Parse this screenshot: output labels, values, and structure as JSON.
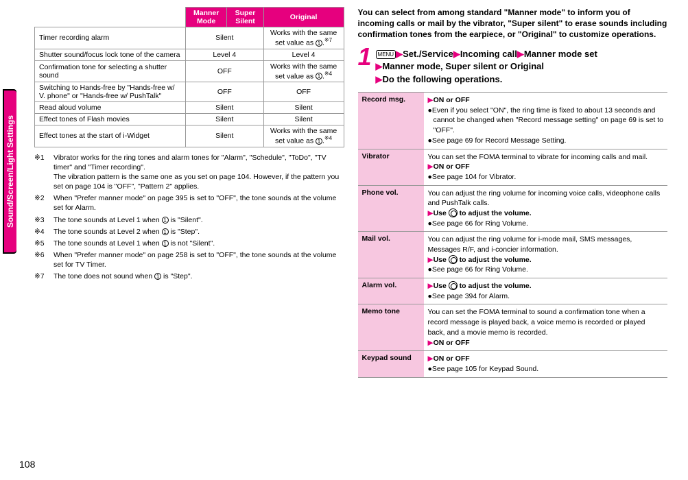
{
  "sideLabel": "Sound/Screen/Light Settings",
  "pageNumber": "108",
  "leftTable": {
    "headers": [
      "",
      "Manner Mode",
      "Super Silent",
      "Original"
    ],
    "rows": [
      {
        "label": "Timer recording alarm",
        "manner": "Silent",
        "super": "",
        "original": "Works with the same set value as ①.※7",
        "mergeMS": true
      },
      {
        "label": "Shutter sound/focus lock tone of the camera",
        "manner": "Level 4",
        "super": "",
        "original": "Level 4",
        "mergeMS": true
      },
      {
        "label": "Confirmation tone for selecting a shutter sound",
        "manner": "OFF",
        "super": "",
        "original": "Works with the same set value as ①.※4",
        "mergeMS": true
      },
      {
        "label": "Switching to Hands-free by \"Hands-free w/ V. phone\" or \"Hands-free w/ PushTalk\"",
        "manner": "OFF",
        "super": "",
        "original": "OFF",
        "mergeMS": true
      },
      {
        "label": "Read aloud volume",
        "manner": "Silent",
        "super": "",
        "original": "Silent",
        "mergeMS": true
      },
      {
        "label": "Effect tones of Flash movies",
        "manner": "Silent",
        "super": "",
        "original": "Silent",
        "mergeMS": true
      },
      {
        "label": "Effect tones at the start of i-Widget",
        "manner": "Silent",
        "super": "",
        "original": "Works with the same set value as ①.※4",
        "mergeMS": true
      }
    ]
  },
  "notes": [
    {
      "marker": "※1",
      "text": "Vibrator works for the ring tones and alarm tones for \"Alarm\", \"Schedule\", \"ToDo\", \"TV timer\" and \"Timer recording\".\nThe vibration pattern is the same one as you set on page 104. However, if the pattern you set on page 104 is \"OFF\", \"Pattern 2\" applies."
    },
    {
      "marker": "※2",
      "text": "When \"Prefer manner mode\" on page 395 is set to \"OFF\", the tone sounds at the volume set for Alarm."
    },
    {
      "marker": "※3",
      "text": "The tone sounds at Level 1 when ① is \"Silent\"."
    },
    {
      "marker": "※4",
      "text": "The tone sounds at Level 2 when ① is \"Step\"."
    },
    {
      "marker": "※5",
      "text": "The tone sounds at Level 1 when ① is not \"Silent\"."
    },
    {
      "marker": "※6",
      "text": "When \"Prefer manner mode\" on page 258 is set to \"OFF\", the tone sounds at the volume set for TV Timer."
    },
    {
      "marker": "※7",
      "text": "The tone does not sound when ① is \"Step\"."
    }
  ],
  "intro": "You can select from among standard \"Manner mode\" to inform you of incoming calls or mail by the vibrator, \"Super silent\" to erase sounds including confirmation tones from the earpiece, or \"Original\" to customize operations.",
  "step": {
    "num": "1",
    "menuKey": "MENU",
    "line1a": "Set./Service",
    "line1b": "Incoming call",
    "line1c": "Manner mode set",
    "line2": "Manner mode, Super silent or Original",
    "line3": "Do the following operations."
  },
  "ops": [
    {
      "label": "Record msg.",
      "pre": "▶ON or OFF",
      "lines": [
        "●Even if you select \"ON\", the ring time is fixed to about 13 seconds and cannot be changed when \"Record message setting\" on page 69 is set to \"OFF\".",
        "●See page 69 for Record Message Setting."
      ]
    },
    {
      "label": "Vibrator",
      "text": "You can set the FOMA terminal to vibrate for incoming calls and mail.",
      "pre": "▶ON or OFF",
      "lines": [
        "●See page 104 for Vibrator."
      ]
    },
    {
      "label": "Phone vol.",
      "text": "You can adjust the ring volume for incoming voice calls, videophone calls and PushTalk calls.",
      "pre": "▶Use ◎ to adjust the volume.",
      "lines": [
        "●See page 66 for Ring Volume."
      ]
    },
    {
      "label": "Mail vol.",
      "text": "You can adjust the ring volume for i-mode mail, SMS messages, Messages R/F, and i-concier information.",
      "pre": "▶Use ◎ to adjust the volume.",
      "lines": [
        "●See page 66 for Ring Volume."
      ]
    },
    {
      "label": "Alarm vol.",
      "pre": "▶Use ◎ to adjust the volume.",
      "lines": [
        "●See page 394 for Alarm."
      ]
    },
    {
      "label": "Memo tone",
      "text": "You can set the FOMA terminal to sound a confirmation tone when a record message is played back, a voice memo is recorded or played back, and a movie memo is recorded.",
      "pre": "▶ON or OFF",
      "lines": []
    },
    {
      "label": "Keypad sound",
      "pre": "▶ON or OFF",
      "lines": [
        "●See page 105 for Keypad Sound."
      ]
    }
  ]
}
